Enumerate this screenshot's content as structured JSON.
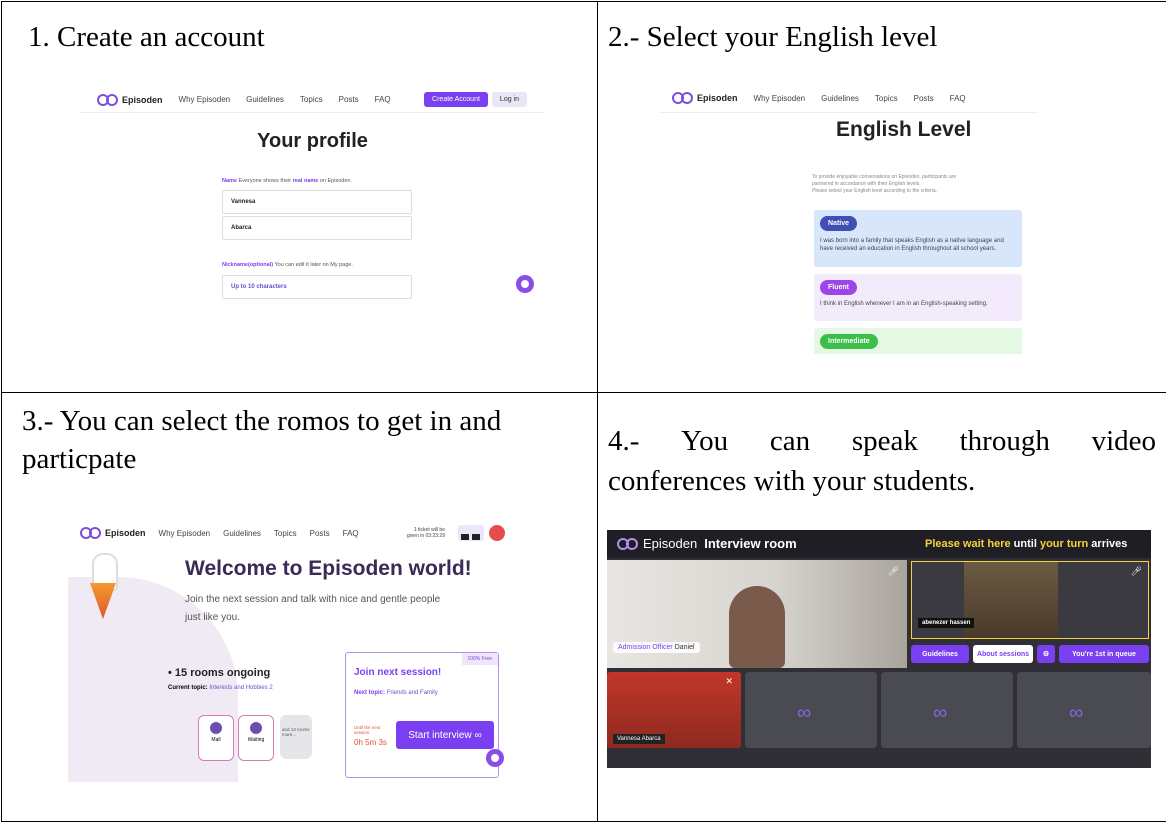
{
  "cells": [
    {
      "caption": "1. Create an account",
      "shot": {
        "brand": "Episoden",
        "nav": [
          "Why Episoden",
          "Guidelines",
          "Topics",
          "Posts",
          "FAQ"
        ],
        "create_account": "Create Account",
        "login": "Log in",
        "title": "Your profile",
        "name_hint_label": "Name",
        "name_hint_text": "Everyone shows their",
        "name_hint_emph": "real name",
        "name_hint_tail": "on Episoden.",
        "first_name": "Vannesa",
        "last_name": "Abarca",
        "nickname_label": "Nickname(optional)",
        "nickname_hint": "You can edit it later on My page.",
        "nickname_placeholder": "Up to 10 characters"
      }
    },
    {
      "caption": "2.- Select your English level",
      "shot": {
        "brand": "Episoden",
        "nav": [
          "Why Episoden",
          "Guidelines",
          "Topics",
          "Posts",
          "FAQ"
        ],
        "title": "English Level",
        "intro_1": "To provide enjoyable conversations on Episoden, participants are",
        "intro_2": "partnered in accordance with their English levels.",
        "intro_3": "Please select your English level according to the criteria.",
        "levels": [
          {
            "name": "Native",
            "desc_1": "I was born into a family that speaks English as a native language and",
            "desc_2": "have received an education in English throughout all school years."
          },
          {
            "name": "Fluent",
            "desc_1": "I think in English whenever I am in an English-speaking setting.",
            "desc_2": ""
          },
          {
            "name": "Intermediate",
            "desc_1": "",
            "desc_2": ""
          }
        ],
        "colors": {
          "native": "#3f4fb5",
          "fluent": "#9b46e8",
          "intermediate": "#3bbf4a"
        }
      }
    },
    {
      "caption_1": "3.- You can select the romos to get in and",
      "caption_2": "particpate",
      "shot": {
        "brand": "Episoden",
        "nav": [
          "Why Episoden",
          "Guidelines",
          "Topics",
          "Posts",
          "FAQ"
        ],
        "ticket_1": "1 ticket will be",
        "ticket_2": "given in 03:23:29",
        "title": "Welcome to Episoden world!",
        "sub_1": "Join the next session and talk with nice and gentle people",
        "sub_2": "just like you.",
        "rooms": "15 rooms ongoing",
        "current_topic_label": "Current topic:",
        "current_topic": "Interests and Hobbies 2",
        "room_a": "Mall",
        "room_b": "Waiting",
        "room_more": "and 13 rooms more...",
        "badge": "100% Free",
        "join_title": "Join next session!",
        "next_topic_label": "Next topic:",
        "next_topic": "Friends and Family",
        "until_1": "Until the next",
        "until_2": "session",
        "countdown": "0h 5m 3s",
        "start": "Start interview"
      }
    },
    {
      "caption_words": [
        "4.-",
        "You",
        "can",
        "speak",
        "through",
        "video"
      ],
      "caption_2": "conferences with your students.",
      "shot": {
        "brand": "Episoden",
        "room_title": "Interview room",
        "wait_pre": "Please wait here",
        "wait_mid": "until",
        "wait_emph": "your turn",
        "wait_post": "arrives",
        "officer_label": "Admission Officer",
        "officer_name": "Daniel",
        "student_name": "abenezer hassen",
        "guidelines": "Guidelines",
        "about": "About sessions",
        "queue": "You're 1st in queue",
        "self_name": "Vannesa Abarca",
        "logo_watermark": "Episoden"
      }
    }
  ]
}
